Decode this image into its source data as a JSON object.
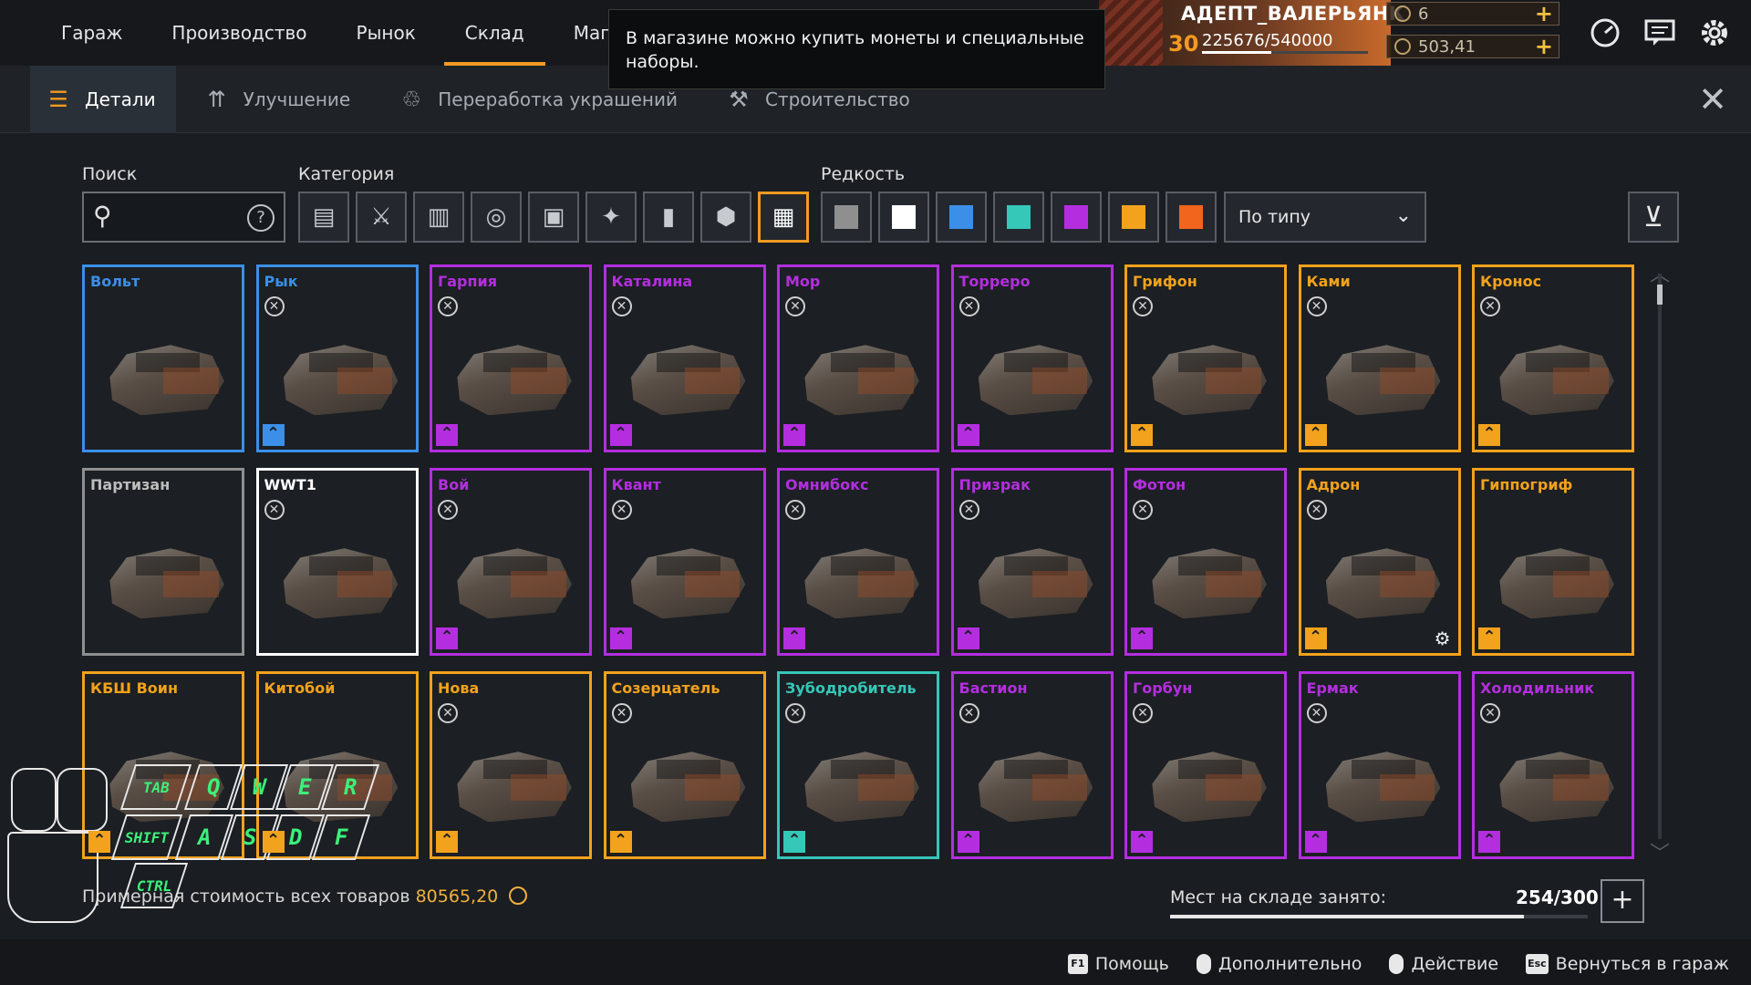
{
  "topnav": {
    "tabs": [
      {
        "label": "Гараж"
      },
      {
        "label": "Производство"
      },
      {
        "label": "Рынок"
      },
      {
        "label": "Склад",
        "active": true
      },
      {
        "label": "Магаз"
      }
    ]
  },
  "tooltip": {
    "text": "В магазине можно купить монеты и специальные наборы."
  },
  "player": {
    "name": "АДЕПТ_ВАЛЕРЬЯНК",
    "level": "30",
    "xp": "225676/540000",
    "xp_progress": 0.418,
    "currency1": "6",
    "currency2": "503,41"
  },
  "icons": {
    "speed": "speedometer-icon",
    "messages": "chat-icon",
    "settings": "gear-icon"
  },
  "subtabs": [
    {
      "label": "Детали",
      "icon": "parts-icon",
      "active": true
    },
    {
      "label": "Улучшение",
      "icon": "upgrade-icon"
    },
    {
      "label": "Переработка украшений",
      "icon": "recycle-icon"
    },
    {
      "label": "Строительство",
      "icon": "build-icon"
    }
  ],
  "filters": {
    "search_label": "Поиск",
    "search_value": "",
    "category_label": "Категория",
    "rarity_label": "Редкость",
    "sort_value": "По типу",
    "categories": [
      {
        "icon": "cabin-icon"
      },
      {
        "icon": "weapon-icon"
      },
      {
        "icon": "module-icon"
      },
      {
        "icon": "wheel-icon"
      },
      {
        "icon": "frame-icon"
      },
      {
        "icon": "decor-icon"
      },
      {
        "icon": "paint-icon"
      },
      {
        "icon": "gear-part-icon"
      },
      {
        "icon": "all-icon",
        "selected": true
      }
    ],
    "rarities": [
      {
        "color": "#8f8f8f"
      },
      {
        "color": "#ffffff"
      },
      {
        "color": "#3b8fe8"
      },
      {
        "color": "#35c7b8"
      },
      {
        "color": "#b42ee0"
      },
      {
        "color": "#f2a21c"
      },
      {
        "color": "#f2651c"
      }
    ]
  },
  "items": [
    {
      "name": "Вольт",
      "rarity": "#3b8fe8",
      "x": false,
      "upgrade": false
    },
    {
      "name": "Рык",
      "rarity": "#3b8fe8",
      "x": true,
      "upgrade": true
    },
    {
      "name": "Гарпия",
      "rarity": "#b42ee0",
      "x": true,
      "upgrade": true
    },
    {
      "name": "Каталина",
      "rarity": "#b42ee0",
      "x": true,
      "upgrade": true
    },
    {
      "name": "Мор",
      "rarity": "#b42ee0",
      "x": true,
      "upgrade": true
    },
    {
      "name": "Торреро",
      "rarity": "#b42ee0",
      "x": true,
      "upgrade": true
    },
    {
      "name": "Грифон",
      "rarity": "#f2a21c",
      "x": true,
      "upgrade": true
    },
    {
      "name": "Ками",
      "rarity": "#f2a21c",
      "x": true,
      "upgrade": true
    },
    {
      "name": "Кронос",
      "rarity": "#f2a21c",
      "x": true,
      "upgrade": true
    },
    {
      "name": "Партизан",
      "rarity": "#8f8f8f",
      "x": false,
      "upgrade": false
    },
    {
      "name": "WWT1",
      "rarity": "#ffffff",
      "x": true,
      "upgrade": false
    },
    {
      "name": "Вой",
      "rarity": "#b42ee0",
      "x": true,
      "upgrade": true
    },
    {
      "name": "Квант",
      "rarity": "#b42ee0",
      "x": true,
      "upgrade": true
    },
    {
      "name": "Омнибокс",
      "rarity": "#b42ee0",
      "x": true,
      "upgrade": true
    },
    {
      "name": "Призрак",
      "rarity": "#b42ee0",
      "x": true,
      "upgrade": true
    },
    {
      "name": "Фотон",
      "rarity": "#b42ee0",
      "x": true,
      "upgrade": true
    },
    {
      "name": "Адрон",
      "rarity": "#f2a21c",
      "x": true,
      "upgrade": true,
      "gear": true
    },
    {
      "name": "Гиппогриф",
      "rarity": "#f2a21c",
      "x": false,
      "upgrade": true
    },
    {
      "name": "КБШ Воин",
      "rarity": "#f2a21c",
      "x": false,
      "upgrade": true
    },
    {
      "name": "Китобой",
      "rarity": "#f2a21c",
      "x": false,
      "upgrade": true
    },
    {
      "name": "Нова",
      "rarity": "#f2a21c",
      "x": true,
      "upgrade": true
    },
    {
      "name": "Созерцатель",
      "rarity": "#f2a21c",
      "x": true,
      "upgrade": true
    },
    {
      "name": "Зубодробитель",
      "rarity": "#35c7b8",
      "x": true,
      "upgrade": true
    },
    {
      "name": "Бастион",
      "rarity": "#b42ee0",
      "x": true,
      "upgrade": true
    },
    {
      "name": "Горбун",
      "rarity": "#b42ee0",
      "x": true,
      "upgrade": true
    },
    {
      "name": "Ермак",
      "rarity": "#b42ee0",
      "x": true,
      "upgrade": true
    },
    {
      "name": "Холодильник",
      "rarity": "#b42ee0",
      "x": true,
      "upgrade": true
    }
  ],
  "footer": {
    "approx_label": "Примерная стоимость всех товаров",
    "approx_value": "80565,20",
    "storage_label": "Мест на складе занято:",
    "storage_value": "254/300",
    "storage_fill": 0.847
  },
  "hints": [
    {
      "key": "F1",
      "label": "Помощь"
    },
    {
      "mouse": true,
      "label": "Дополнительно"
    },
    {
      "mouse": true,
      "label": "Действие"
    },
    {
      "key": "Esc",
      "label": "Вернуться в гараж"
    }
  ],
  "keyboard": {
    "keys": [
      "TAB",
      "Q",
      "W",
      "E",
      "R",
      "SHIFT",
      "A",
      "S",
      "D",
      "F",
      "CTRL"
    ]
  }
}
